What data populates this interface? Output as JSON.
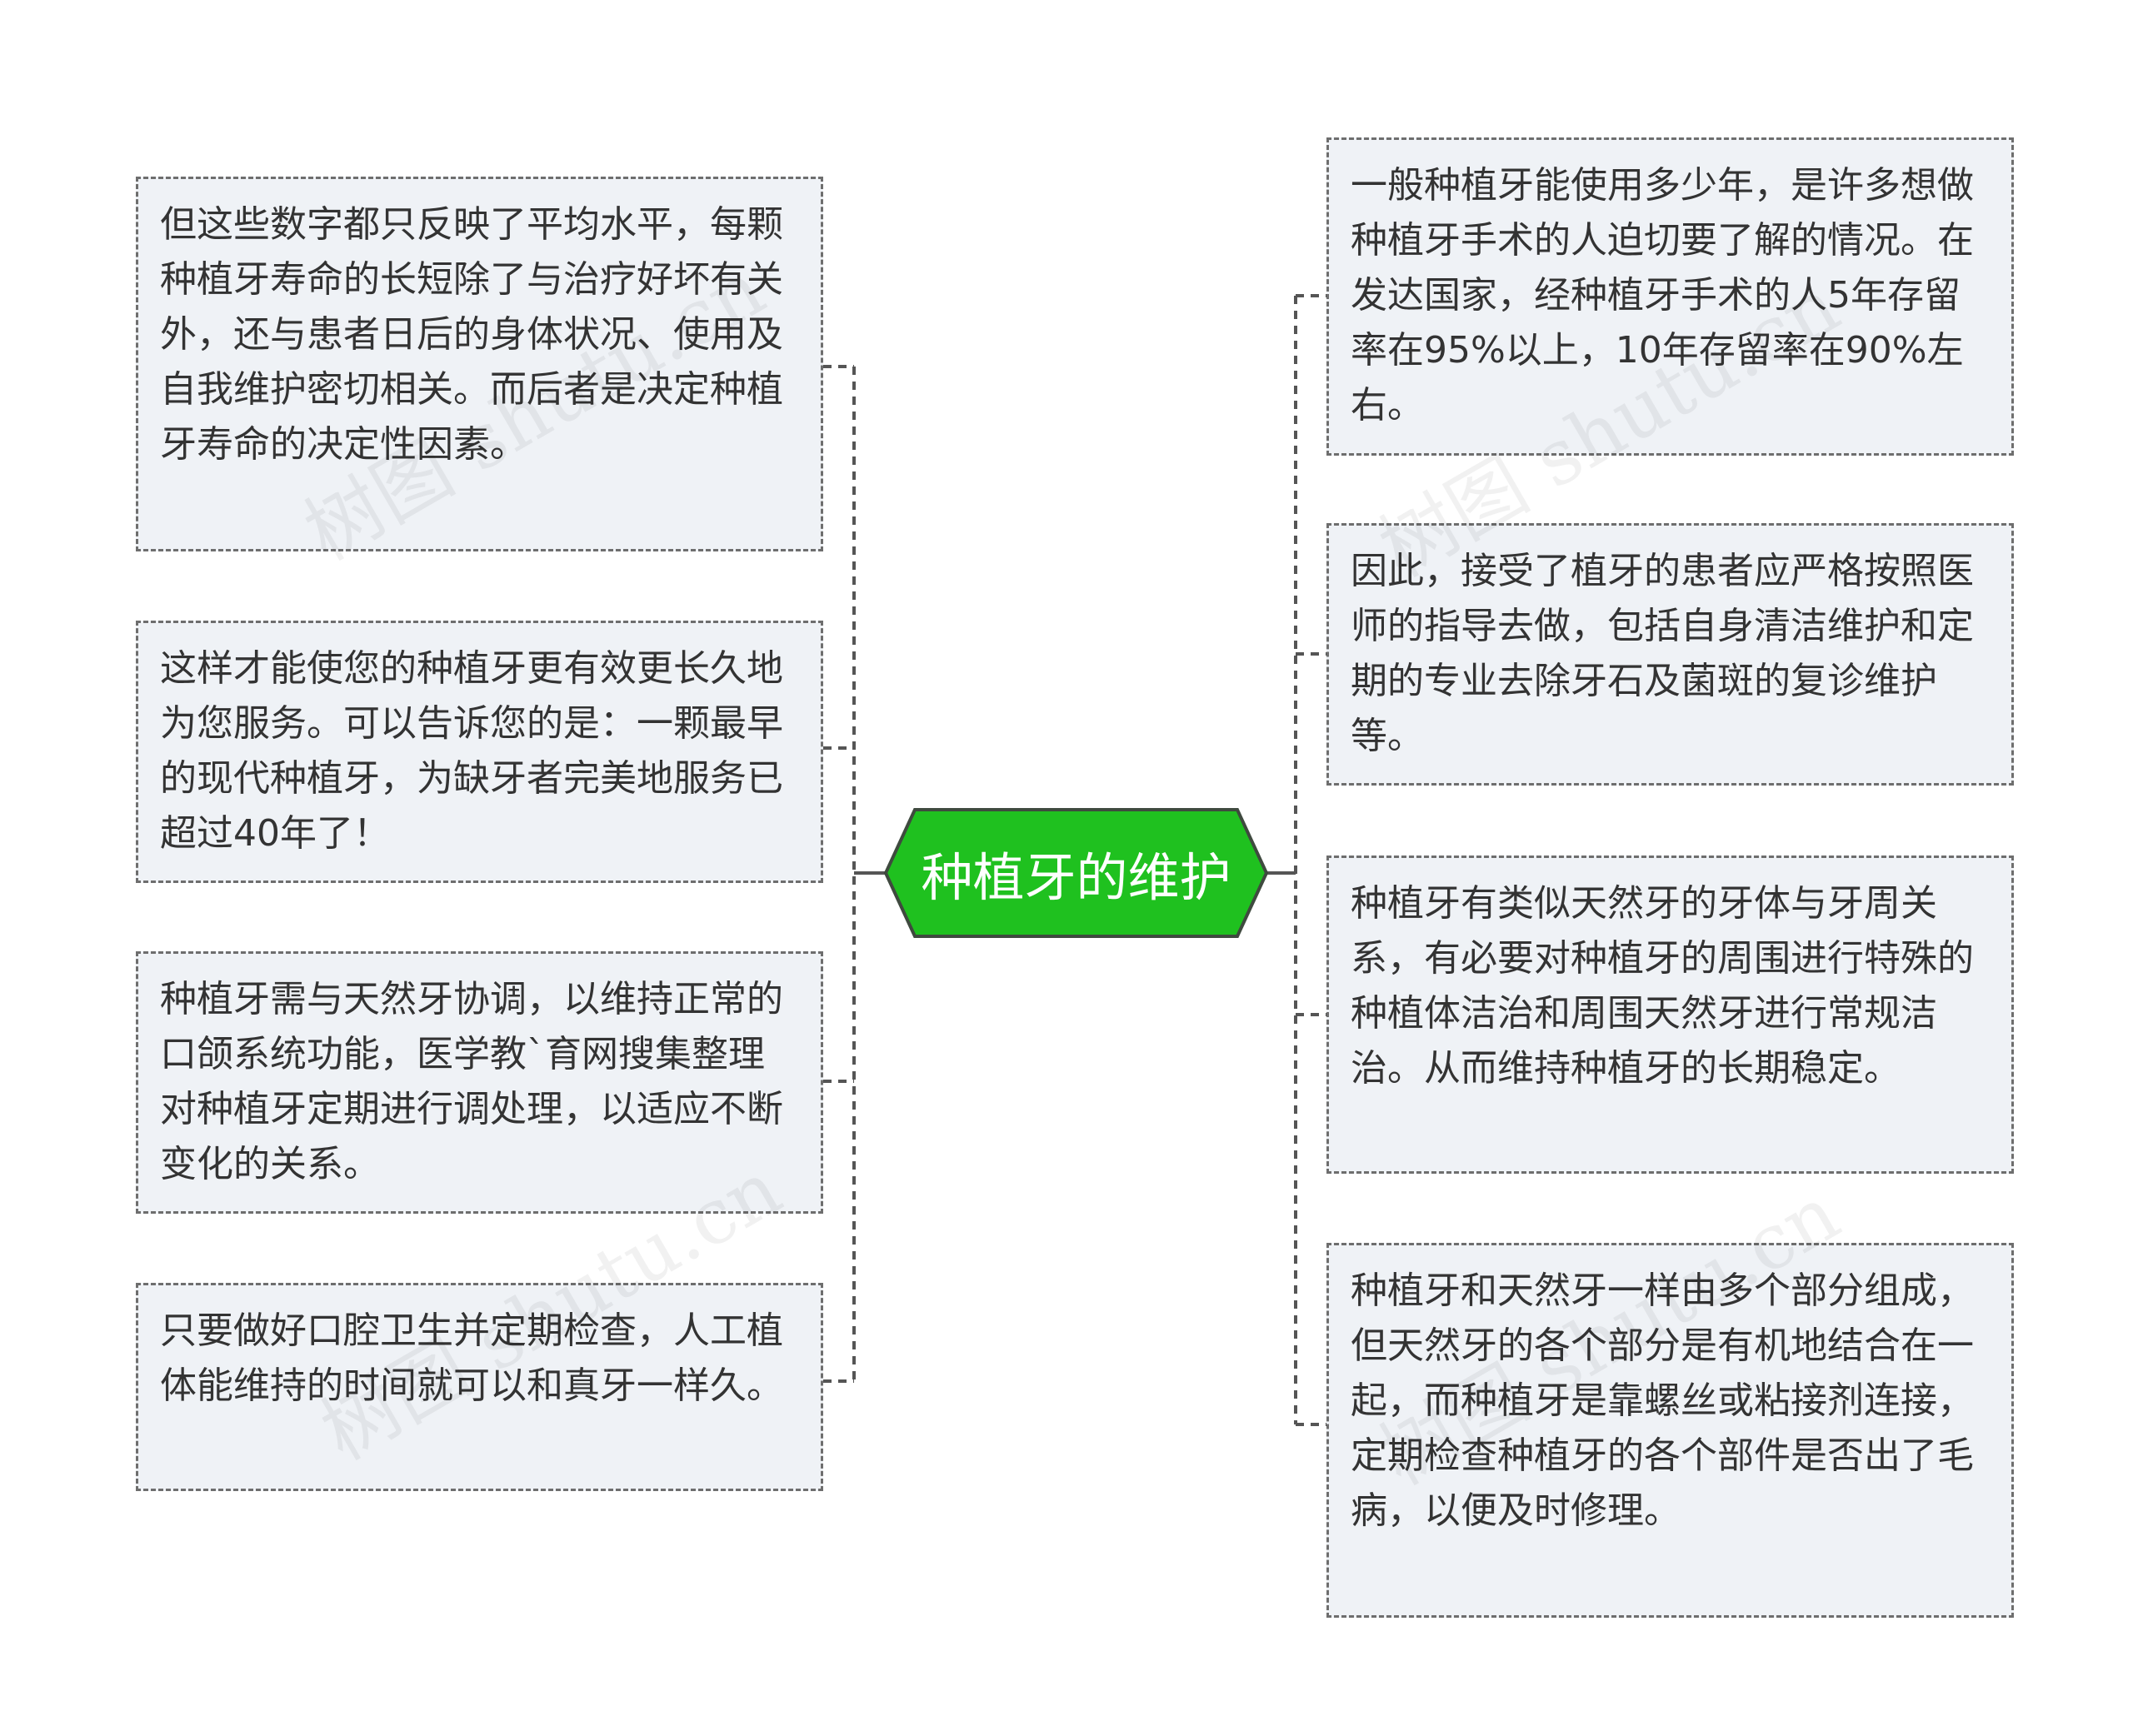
{
  "root": {
    "label": "种植牙的维护",
    "fill": "#1fc11f",
    "stroke": "#3f4a3f"
  },
  "left_nodes": [
    {
      "text": "但这些数字都只反映了平均水平，每颗种植牙寿命的长短除了与治疗好坏有关外，还与患者日后的身体状况、使用及自我维护密切相关。而后者是决定种植牙寿命的决定性因素。"
    },
    {
      "text": "这样才能使您的种植牙更有效更长久地为您服务。可以告诉您的是：一颗最早的现代种植牙，为缺牙者完美地服务已超过40年了！"
    },
    {
      "text": "种植牙需与天然牙协调，以维持正常的口颌系统功能，医学教`育网搜集整理对种植牙定期进行调处理，以适应不断变化的关系。"
    },
    {
      "text": "只要做好口腔卫生并定期检查，人工植体能维持的时间就可以和真牙一样久。"
    }
  ],
  "right_nodes": [
    {
      "text": "一般种植牙能使用多少年，是许多想做种植牙手术的人迫切要了解的情况。在发达国家，经种植牙手术的人5年存留率在95%以上，10年存留率在90%左右。"
    },
    {
      "text": "因此，接受了植牙的患者应严格按照医师的指导去做，包括自身清洁维护和定期的专业去除牙石及菌斑的复诊维护等。"
    },
    {
      "text": "种植牙有类似天然牙的牙体与牙周关系，有必要对种植牙的周围进行特殊的种植体洁治和周围天然牙进行常规洁治。从而维持种植牙的长期稳定。"
    },
    {
      "text": "种植牙和天然牙一样由多个部分组成，但天然牙的各个部分是有机地结合在一起，而种植牙是靠螺丝或粘接剂连接，定期检查种植牙的各个部件是否出了毛病，以便及时修理。"
    }
  ],
  "watermark": "树图 shutu.cn",
  "colors": {
    "node_fill": "#eff2f6",
    "node_border": "#6e6e6e",
    "connector": "#555555"
  }
}
